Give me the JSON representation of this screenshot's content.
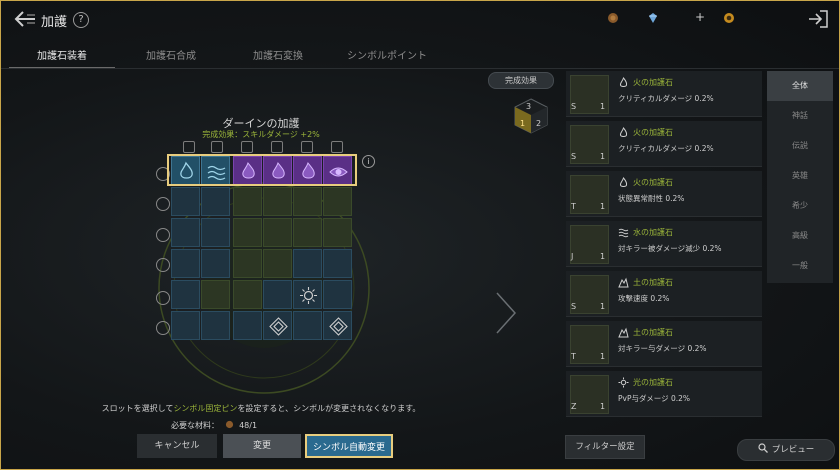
{
  "header": {
    "title": "加護",
    "help": "?",
    "plus": "+"
  },
  "tabs": [
    {
      "label": "加護石装着"
    },
    {
      "label": "加護石合成"
    },
    {
      "label": "加護石変換"
    },
    {
      "label": "シンボルポイント"
    }
  ],
  "board": {
    "complete_button": "完成効果",
    "cube_numbers": [
      "3",
      "1",
      "2"
    ],
    "title": "ダーインの加護",
    "subtitle": "完成効果：スキルダメージ +2%"
  },
  "hint": {
    "before": "スロットを選択して",
    "highlight": "シンボル固定ピン",
    "after": "を設定すると、シンボルが変更されなくなります。"
  },
  "material": {
    "label": "必要な材料：",
    "value": "48/1"
  },
  "buttons": {
    "cancel": "キャンセル",
    "change": "変更",
    "auto_change": "シンボル自動変更"
  },
  "stones": [
    {
      "level": "S",
      "count": "1",
      "name": "火の加護石",
      "effect": "クリティカルダメージ 0.2%"
    },
    {
      "level": "S",
      "count": "1",
      "name": "火の加護石",
      "effect": "クリティカルダメージ 0.2%"
    },
    {
      "level": "T",
      "count": "1",
      "name": "火の加護石",
      "effect": "状態異常耐性 0.2%"
    },
    {
      "level": "J",
      "count": "1",
      "name": "水の加護石",
      "effect": "対キラー被ダメージ減少 0.2%"
    },
    {
      "level": "S",
      "count": "1",
      "name": "土の加護石",
      "effect": "攻撃速度 0.2%"
    },
    {
      "level": "T",
      "count": "1",
      "name": "土の加護石",
      "effect": "対キラー与ダメージ 0.2%"
    },
    {
      "level": "Z",
      "count": "1",
      "name": "光の加護石",
      "effect": "PvP与ダメージ 0.2%"
    }
  ],
  "categories": [
    "全体",
    "神話",
    "伝説",
    "英雄",
    "希少",
    "高級",
    "一般"
  ],
  "filter_button": "フィルター設定",
  "preview_button": "プレビュー",
  "colors": {
    "accent_gold": "#e8cd7e",
    "green_text": "#9bb53a",
    "purple_cell": "#5a2f86",
    "blue_button": "#2a6a8f"
  }
}
